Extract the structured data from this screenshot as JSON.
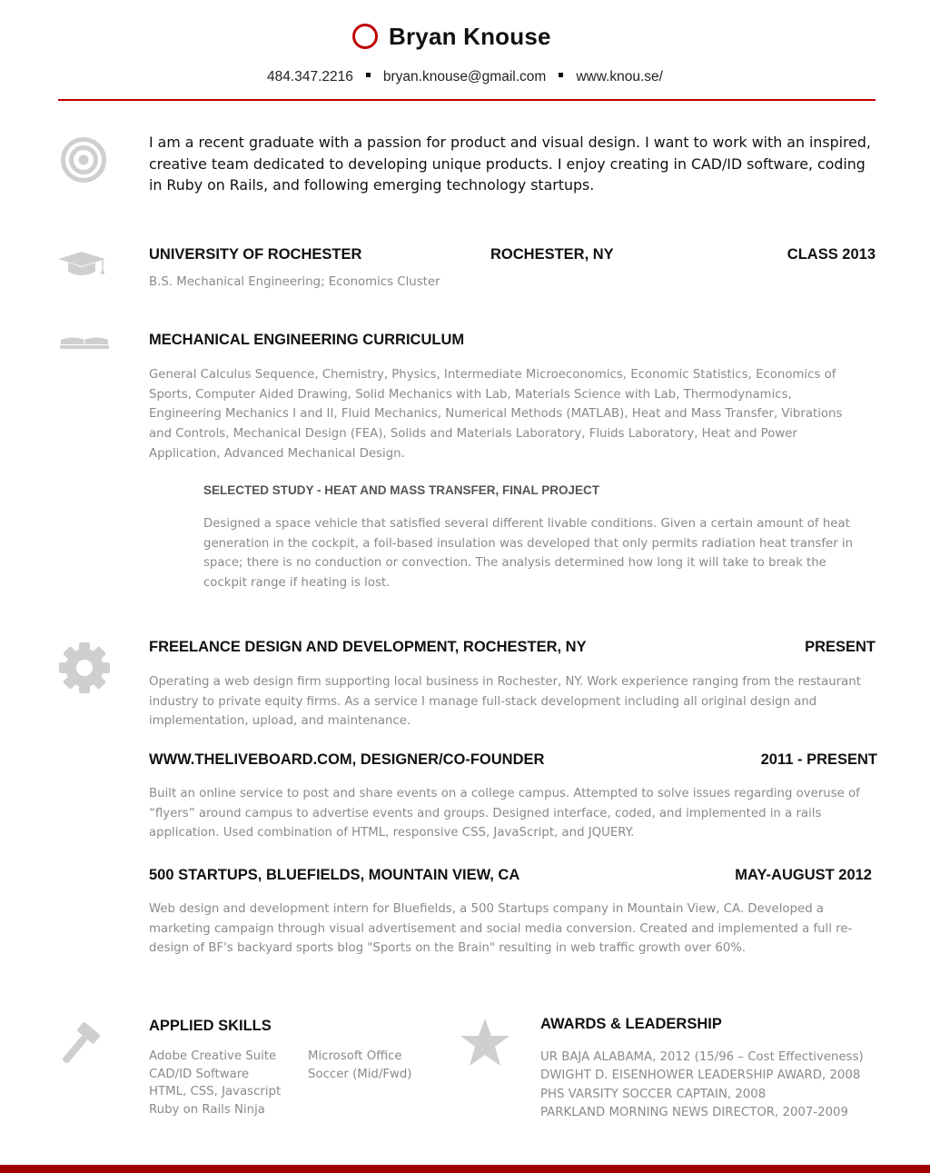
{
  "header": {
    "name": "Bryan Knouse",
    "phone": "484.347.2216",
    "email": "bryan.knouse@gmail.com",
    "website": "www.knou.se/"
  },
  "objective": "I am a recent graduate with a passion for product and visual design.  I want to work with an inspired, creative team dedicated to developing unique products.  I enjoy creating in CAD/ID software, coding in Ruby on Rails, and following emerging technology startups.",
  "education": {
    "school": "UNIVERSITY OF ROCHESTER",
    "location": "ROCHESTER, NY",
    "class_year": "CLASS 2013",
    "degree": "B.S. Mechanical Engineering; Economics Cluster"
  },
  "curriculum": {
    "title": "MECHANICAL ENGINEERING CURRICULUM",
    "courses": "General Calculus Sequence, Chemistry, Physics, Intermediate Microeconomics, Economic Statistics, Economics of Sports, Computer Aided Drawing, Solid Mechanics with Lab,  Materials Science with Lab, Thermodynamics, Engineering Mechanics I and II, Fluid Mechanics, Numerical Methods (MATLAB), Heat and Mass Transfer, Vibrations and Controls, Mechanical Design (FEA), Solids and Materials Laboratory, Fluids Laboratory,  Heat and Power Application, Advanced Mechanical Design.",
    "study_title": "SELECTED STUDY - HEAT AND MASS TRANSFER, FINAL PROJECT",
    "study_description": "Designed a space vehicle that satisfied several different livable conditions.  Given a certain amount of heat generation in the cockpit, a foil-based insulation was developed that only permits radiation heat transfer in space; there is no conduction or convection.  The analysis determined how long it will take to break the cockpit range if heating is lost."
  },
  "experience": [
    {
      "title": "FREELANCE DESIGN AND DEVELOPMENT, ROCHESTER, NY",
      "date": "PRESENT",
      "description": "Operating a web design firm supporting local business in Rochester, NY.  Work experience ranging from the restaurant industry to private equity firms.  As a service I manage full-stack development including all original design and implementation, upload, and maintenance."
    },
    {
      "title": "WWW.THELIVEBOARD.COM, DESIGNER/CO-FOUNDER",
      "date": "2011 - PRESENT",
      "description": "Built an online service to post and share events on a college campus.  Attempted to solve issues regarding overuse of “flyers” around campus to advertise events and groups.  Designed interface, coded, and implemented in a rails application.  Used combination of HTML, responsive CSS, JavaScript, and JQUERY."
    },
    {
      "title": "500 STARTUPS, BLUEFIELDS, MOUNTAIN VIEW, CA",
      "date": "MAY-AUGUST 2012",
      "description": "Web design and development intern for Bluefields, a 500 Startups company in Mountain View, CA. Developed a marketing campaign through visual advertisement and social media conversion. Created and implemented a full re-design of BF's backyard sports blog \"Sports on the Brain\" resulting in web traffic growth over 60%."
    }
  ],
  "skills": {
    "title": "APPLIED SKILLS",
    "column1": [
      "Adobe Creative Suite",
      "CAD/ID Software",
      "HTML, CSS, Javascript",
      "Ruby on Rails Ninja"
    ],
    "column2": [
      "Microsoft Office",
      "Soccer (Mid/Fwd)"
    ]
  },
  "awards": {
    "title": "AWARDS & LEADERSHIP",
    "items": [
      "UR BAJA ALABAMA, 2012 (15/96 – Cost Effectiveness)",
      "DWIGHT D. EISENHOWER LEADERSHIP AWARD, 2008",
      "PHS VARSITY SOCCER CAPTAIN, 2008",
      "PARKLAND MORNING NEWS DIRECTOR, 2007-2009"
    ]
  },
  "colors": {
    "accent": "#c00000",
    "icon": "#cfcfcf",
    "body_text": "#8a8a8a"
  },
  "icons": [
    "target-icon",
    "graduation-cap-icon",
    "open-book-icon",
    "gear-icon",
    "hammer-icon",
    "star-icon"
  ]
}
